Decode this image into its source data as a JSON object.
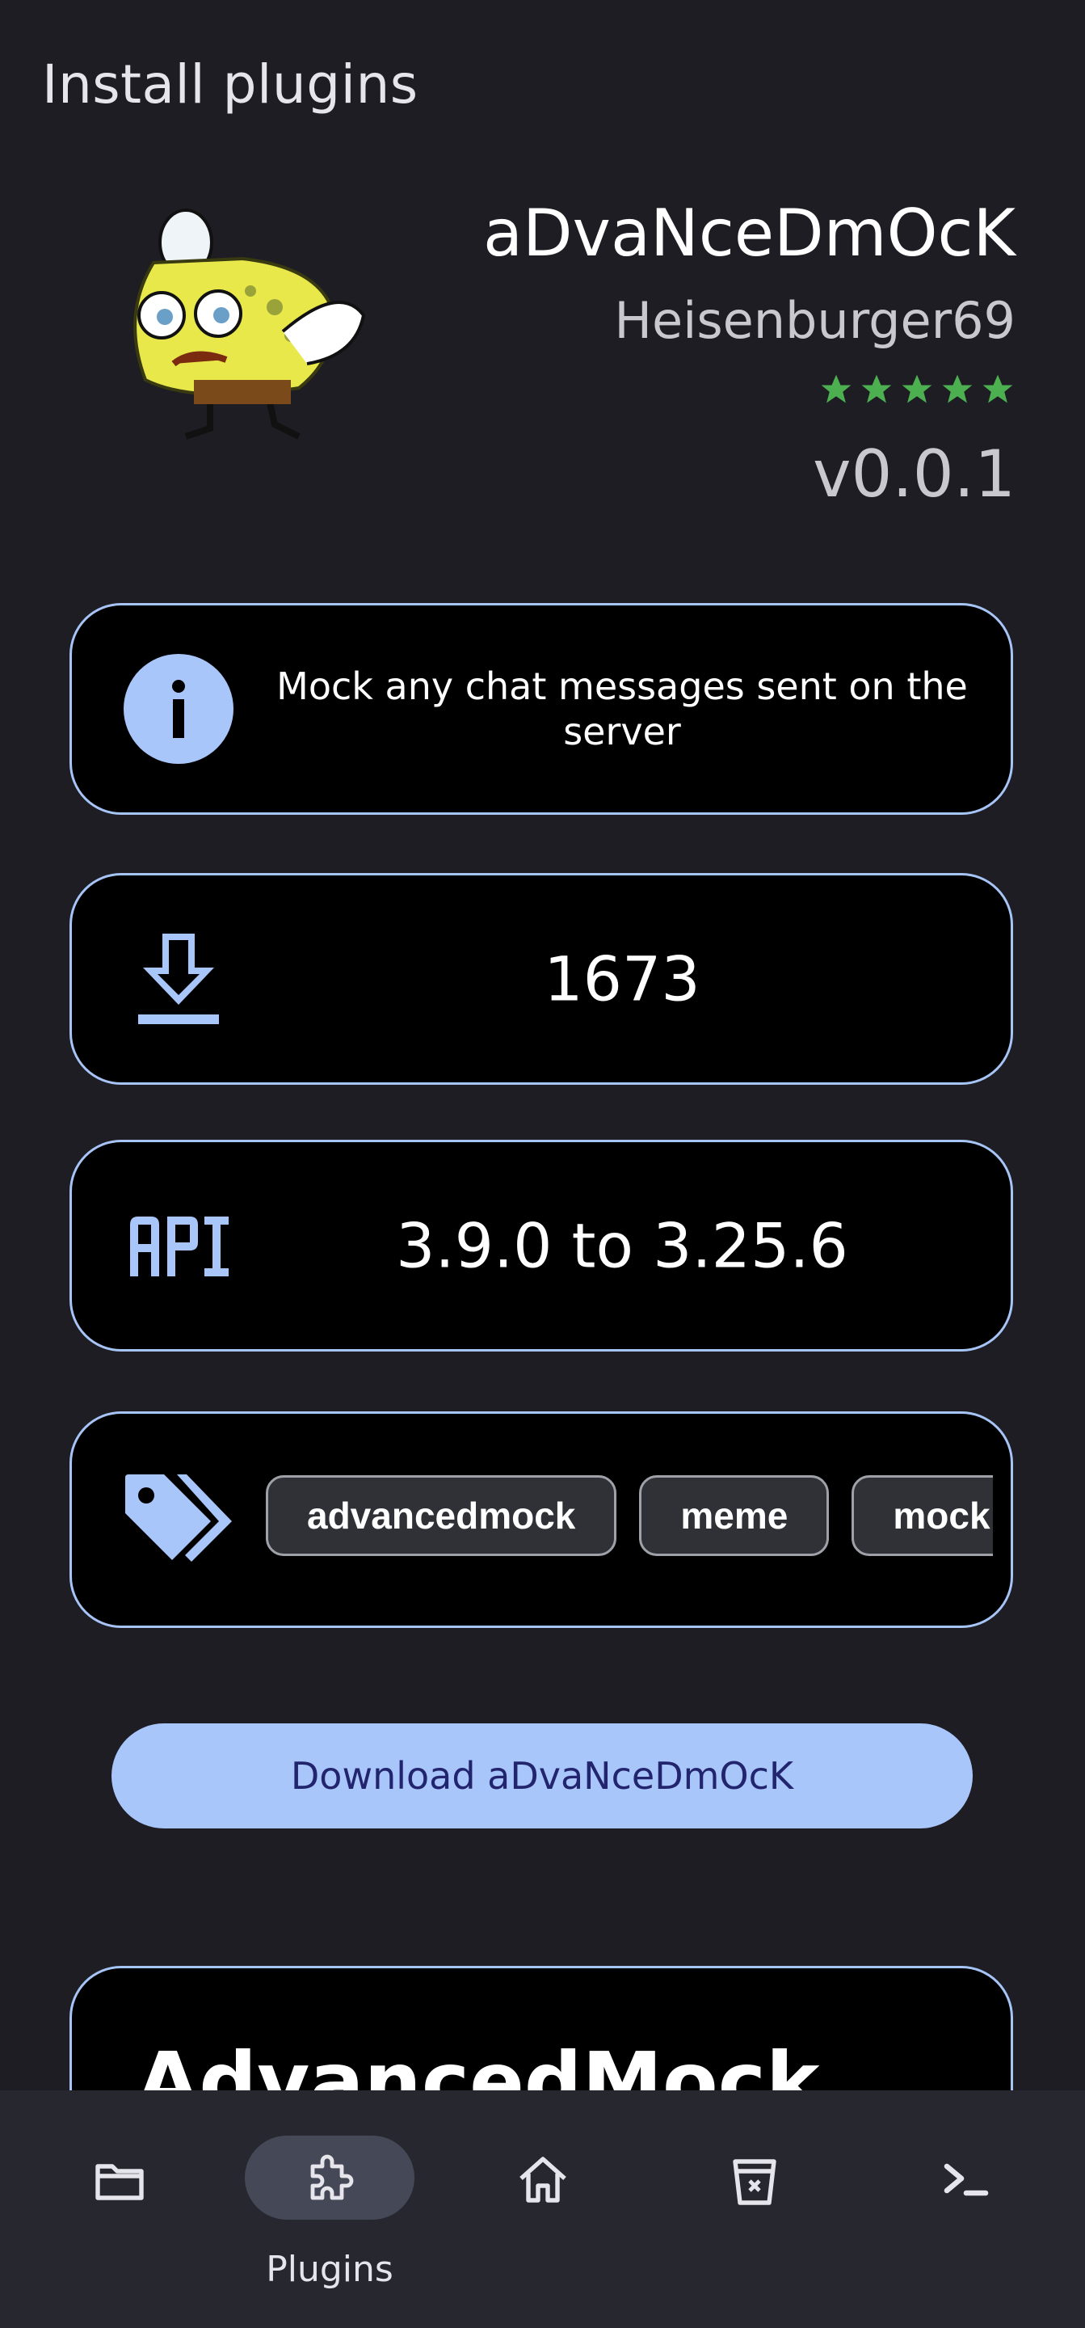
{
  "header": {
    "title": "Install plugins"
  },
  "plugin": {
    "name": "aDvaNceDmOcK",
    "author": "Heisenburger69",
    "rating": 5,
    "rating_max": 5,
    "version": "v0.0.1",
    "description": "Mock any chat messages sent on the server",
    "downloads": "1673",
    "api": "3.9.0 to 3.25.6",
    "tags": [
      "advancedmock",
      "meme",
      "mock"
    ]
  },
  "actions": {
    "download_label": "Download aDvaNceDmOcK"
  },
  "readme": {
    "title": "AdvancedMock"
  },
  "nav": {
    "items": [
      {
        "icon": "folder-icon",
        "label": ""
      },
      {
        "icon": "puzzle-icon",
        "label": "Plugins",
        "active": true
      },
      {
        "icon": "home-icon",
        "label": ""
      },
      {
        "icon": "trash-icon",
        "label": ""
      },
      {
        "icon": "terminal-icon",
        "label": ""
      }
    ]
  },
  "colors": {
    "background": "#1d1d23",
    "accent": "#a9c6fb",
    "star": "#4caf50",
    "card_border": "#a7c4f7"
  }
}
